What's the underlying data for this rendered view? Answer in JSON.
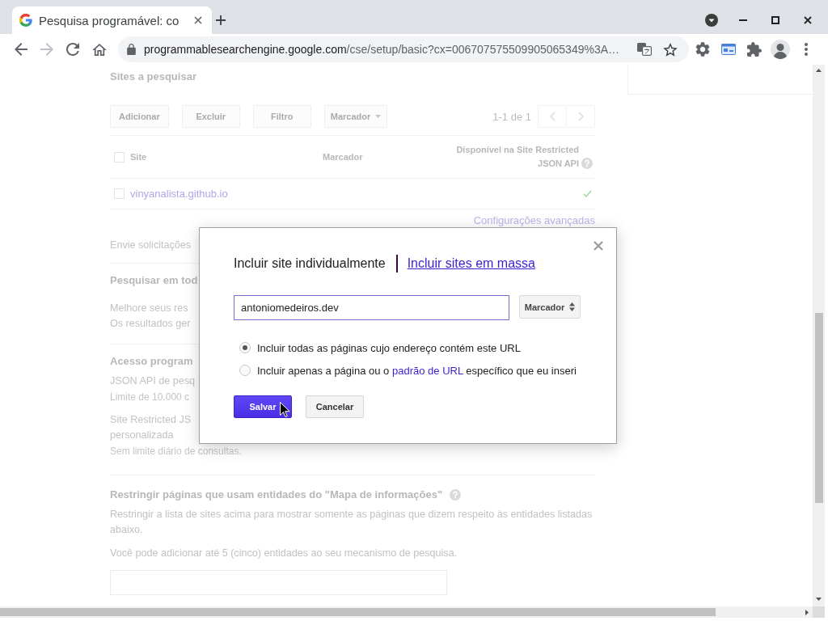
{
  "browser": {
    "tabs": [
      {
        "title": "Pesquisa programável: co",
        "selected": true
      }
    ],
    "nav_buttons": [
      {
        "kind": "back",
        "disabled": false
      },
      {
        "kind": "forward",
        "disabled": true
      },
      {
        "kind": "reload",
        "disabled": false
      },
      {
        "kind": "home",
        "disabled": false
      }
    ],
    "url": {
      "host": "programmablesearchengine.google.com",
      "path": "/cse/setup/basic?cx=006707575509905065349%3A…"
    }
  },
  "page": {
    "sites": {
      "title": "Sites a pesquisar",
      "toolbar": [
        {
          "label": "Adicionar",
          "kind": "button"
        },
        {
          "label": "Excluir",
          "kind": "button"
        },
        {
          "label": "Filtro",
          "kind": "button"
        },
        {
          "label": "Marcador",
          "kind": "dropdown"
        }
      ],
      "page_range": "1-1 de 1",
      "select_all_checked": false,
      "columns": [
        {
          "label": "Site"
        },
        {
          "label": "Marcador"
        },
        {
          "label": "Disponível na Site Restricted JSON API",
          "help": true
        }
      ],
      "rows": [
        {
          "site": "vinyanalista.github.io",
          "checked": false,
          "json_api": true
        }
      ],
      "advanced_link": "Configurações avançadas"
    },
    "send_requests": {
      "text": "Envie solicitações"
    },
    "search_all": {
      "title": "Pesquisar em tod",
      "lines": [
        "Melhore seus res",
        "Os resultados ger"
      ]
    },
    "programmatic_access": {
      "title": "Acesso program",
      "items": [
        {
          "lines": [
            "JSON API de pesq"
          ],
          "note": "Limite de 10.000 c"
        },
        {
          "lines": [
            "Site Restricted JS",
            "personalizada"
          ],
          "note": "Sem limite diário de consultas."
        }
      ]
    },
    "entities": {
      "title": "Restringir páginas que usam entidades do \"Mapa de informações\"",
      "help": true,
      "description": "Restringir a lista de sites acima para mostrar somente as páginas que dizem respeito às entidades listadas abaixo.",
      "limit_note": "Você pode adicionar até 5 (cinco) entidades ao seu mecanismo de pesquisa."
    }
  },
  "dialog": {
    "tabs": [
      {
        "label": "Incluir site individualmente",
        "selected": true
      },
      {
        "label": "Incluir sites em massa",
        "selected": false
      }
    ],
    "site_input": {
      "value": "antoniomedeiros.dev",
      "focused": true
    },
    "label_select": {
      "label": "Marcador"
    },
    "options": [
      {
        "selected": true,
        "parts": [
          {
            "kind": "text",
            "text": "Incluir todas as páginas cujo endereço contém este URL"
          }
        ]
      },
      {
        "selected": false,
        "parts": [
          {
            "kind": "text",
            "text": "Incluir apenas a página ou o"
          },
          {
            "kind": "link",
            "text": "padrão de URL"
          },
          {
            "kind": "text",
            "text": "específico que eu inseri"
          }
        ]
      }
    ],
    "buttons": [
      {
        "label": "Salvar",
        "kind": "primary"
      },
      {
        "label": "Cancelar",
        "kind": "secondary"
      }
    ]
  }
}
